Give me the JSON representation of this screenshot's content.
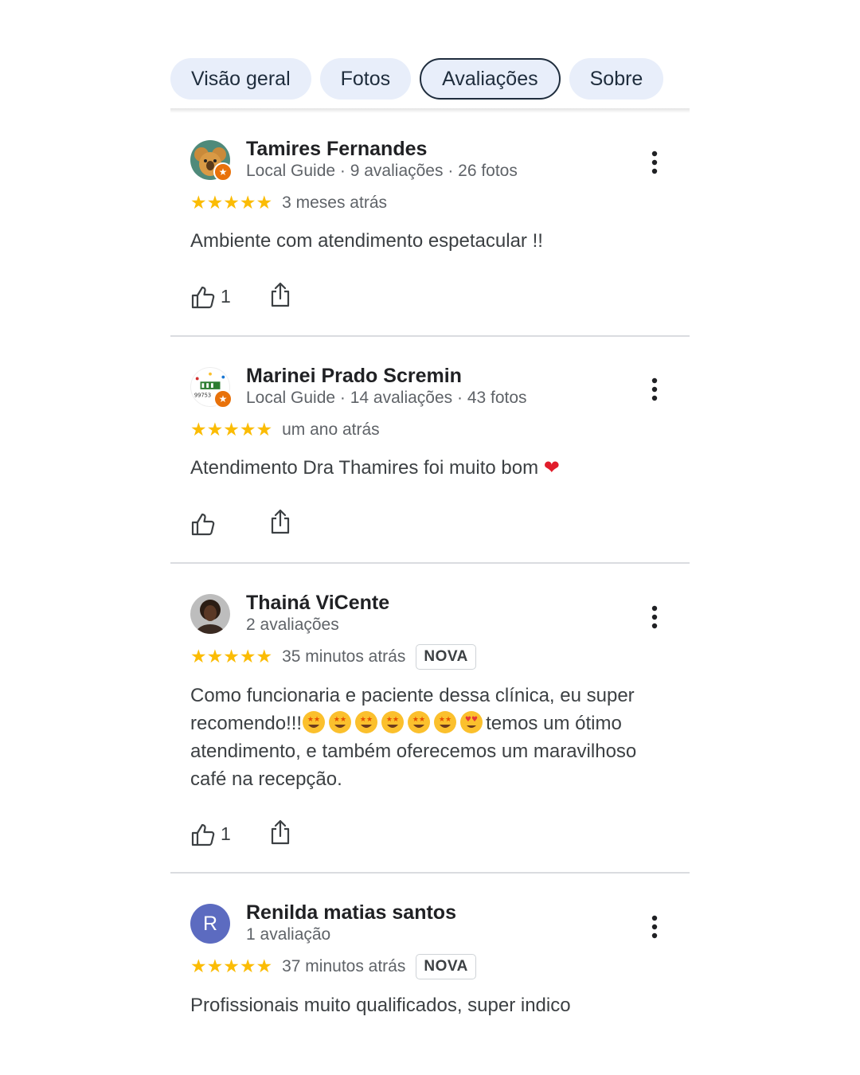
{
  "tabs": [
    {
      "label": "Visão geral",
      "active": false
    },
    {
      "label": "Fotos",
      "active": false
    },
    {
      "label": "Avaliações",
      "active": true
    },
    {
      "label": "Sobre",
      "active": false
    }
  ],
  "colors": {
    "star": "#fbbc04",
    "tab_bg": "#e8eefa",
    "local_guide_badge": "#e8710a",
    "avatar_letter_bg": "#5c6bc0"
  },
  "reviews": [
    {
      "name": "Tamires Fernandes",
      "meta": "Local Guide · 9 avaliações · 26 fotos",
      "local_guide": true,
      "avatar_icon": "koala-avatar",
      "stars": "★★★★★",
      "rating": 5,
      "when": "3 meses atrás",
      "badge": "",
      "text": "Ambiente com atendimento espetacular !!",
      "likes": "1"
    },
    {
      "name": "Marinei Prado Scremin",
      "meta": "Local Guide · 14 avaliações · 43 fotos",
      "local_guide": true,
      "avatar_icon": "logo-avatar",
      "avatar_logo_text": "99753",
      "stars": "★★★★★",
      "rating": 5,
      "when": "um ano atrás",
      "badge": "",
      "text": "Atendimento Dra Thamires foi muito bom",
      "text_emoji": "❤",
      "likes": ""
    },
    {
      "name": "Thainá ViCente",
      "meta": "2 avaliações",
      "local_guide": false,
      "avatar_icon": "photo-avatar",
      "stars": "★★★★★",
      "rating": 5,
      "when": "35 minutos atrás",
      "badge": "NOVA",
      "text_part1": "Como funcionaria e paciente dessa clínica, eu super recomendo!!!",
      "text_part2": "temos um ótimo atendimento, e também oferecemos um maravilhoso café na recepção.",
      "likes": "1"
    },
    {
      "name": "Renilda matias santos",
      "meta": "1 avaliação",
      "local_guide": false,
      "avatar_letter": "R",
      "stars": "★★★★★",
      "rating": 5,
      "when": "37 minutos atrás",
      "badge": "NOVA",
      "text": "Profissionais muito qualificados, super indico"
    }
  ]
}
